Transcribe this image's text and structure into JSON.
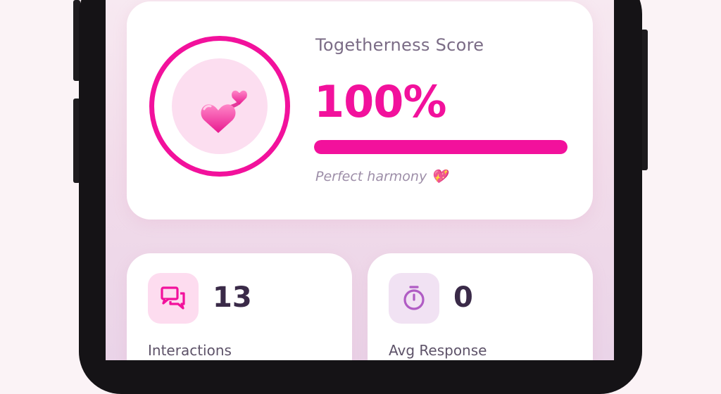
{
  "score": {
    "title": "Togetherness Score",
    "value": "100%",
    "progress_percent": 100,
    "caption": "Perfect harmony 💖",
    "icon": "revolving-hearts-icon",
    "accent_color": "#f2119c"
  },
  "stats": [
    {
      "value": "13",
      "label": "Interactions",
      "icon": "chat-bubbles-icon",
      "color": "#f2119c"
    },
    {
      "value": "0",
      "label": "Avg Response",
      "icon": "stopwatch-icon",
      "color": "#b05cc4"
    }
  ]
}
